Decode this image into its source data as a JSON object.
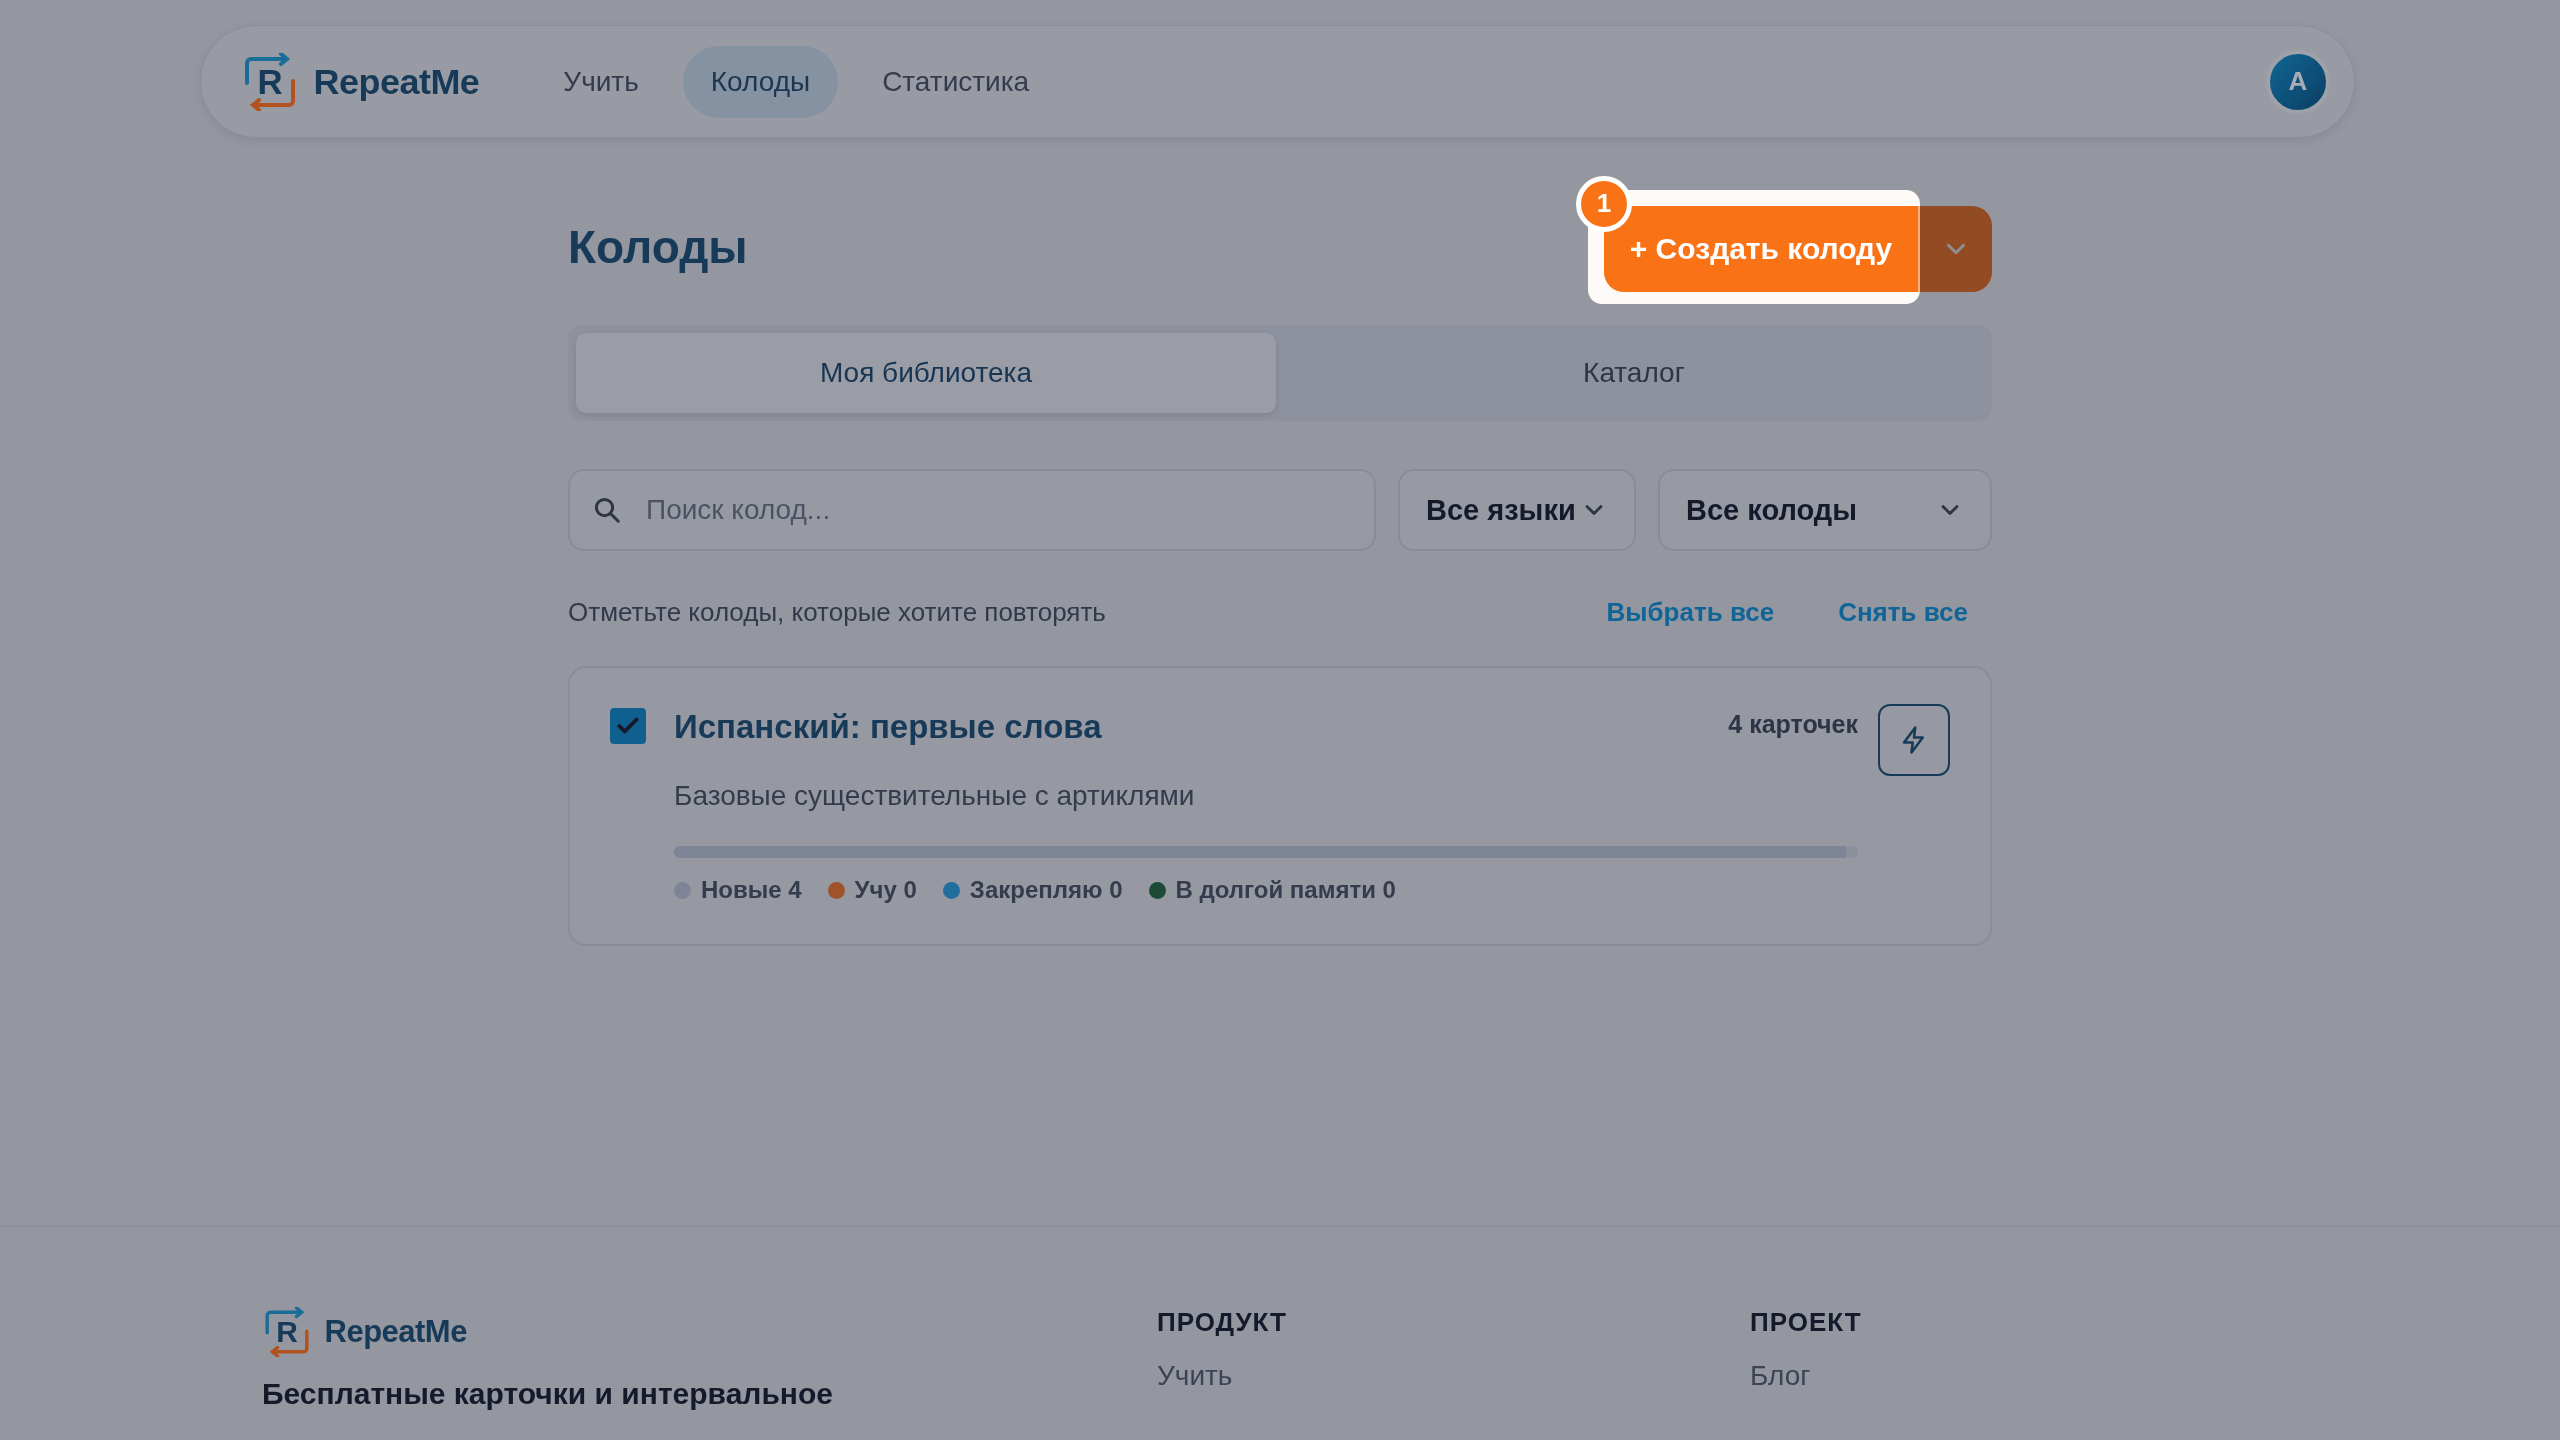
{
  "header": {
    "logo": {
      "mark": "R",
      "name": "RepeatMe"
    },
    "nav": [
      {
        "label": "Учить",
        "selected": false
      },
      {
        "label": "Колоды",
        "selected": true
      },
      {
        "label": "Статистика",
        "selected": false
      }
    ],
    "avatar": "A"
  },
  "page_title": "Колоды",
  "create_button": {
    "label": "+ Создать колоду",
    "tour_step": "1"
  },
  "tabs": [
    {
      "label": "Моя библиотека",
      "selected": true
    },
    {
      "label": "Каталог",
      "selected": false
    }
  ],
  "search": {
    "placeholder": "Поиск колод..."
  },
  "filters": [
    {
      "label": "Все языки"
    },
    {
      "label": "Все колоды"
    }
  ],
  "hint": "Отметьте колоды, которые хотите повторять",
  "select_links": [
    "Выбрать все",
    "Снять все"
  ],
  "decks": [
    {
      "title": "Испанский: первые слова",
      "description": "Базовые существительные с артиклями",
      "count": "4 карточек",
      "checked": true,
      "stats": [
        {
          "label": "Новые 4",
          "color": "#7d8596",
          "level": 0.99
        },
        {
          "label": "Учу 0",
          "color": "#a0522a",
          "level": 0
        },
        {
          "label": "Закрепляю 0",
          "color": "#1f6e9c",
          "level": 0
        },
        {
          "label": "В долгой памяти 0",
          "color": "#1b4a36",
          "level": 0
        }
      ]
    }
  ],
  "footer": {
    "logo": {
      "mark": "R",
      "name": "RepeatMe"
    },
    "tagline": "Бесплатные карточки и интервальное",
    "columns": [
      {
        "heading": "ПРОДУКТ",
        "links": [
          "Учить"
        ]
      },
      {
        "heading": "ПРОЕКТ",
        "links": [
          "Блог"
        ]
      }
    ]
  }
}
